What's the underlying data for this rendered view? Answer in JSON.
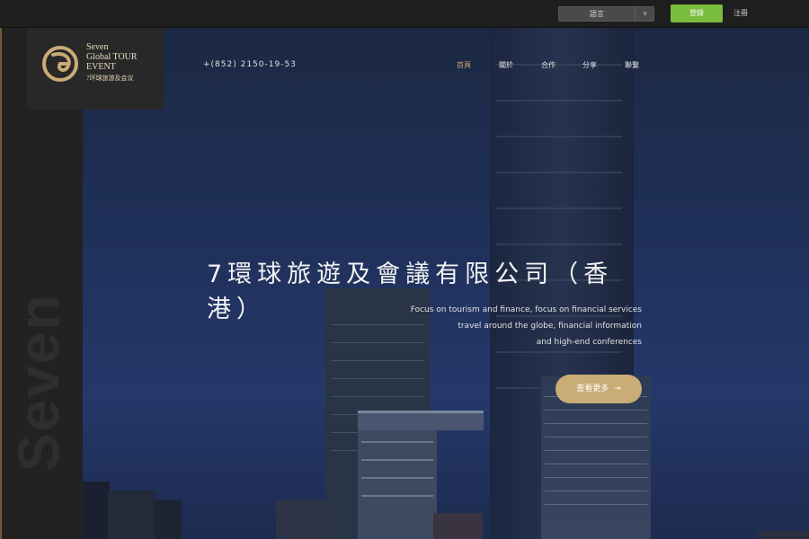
{
  "topbar": {
    "language_label": "語言",
    "language_caret": "∨",
    "login_label": "登錄",
    "register_label": "注冊"
  },
  "logo": {
    "line1": "Seven",
    "line2": "Global TOUR",
    "line3": "EVENT",
    "line4": "7环球旅游及会议"
  },
  "side": {
    "background_word": "Seven"
  },
  "header": {
    "phone": "+(852) 2150-19-53",
    "nav": [
      "首頁",
      "關於",
      "合作",
      "分享",
      "聯繫"
    ],
    "active_index": 0
  },
  "hero": {
    "title": "7環球旅遊及會議有限公司（香港）",
    "taglines": [
      "Focus on tourism and finance, focus on financial services",
      "travel around the globe, financial information",
      "and high-end conferences"
    ],
    "more_label": "查看更多",
    "more_arrow": "→"
  },
  "colors": {
    "accent_gold": "#c9ac76",
    "login_green": "#7bbd3c",
    "hero_navy": "#1f3059"
  },
  "icons": [
    "logo-swirl-icon",
    "chevron-down-icon",
    "arrow-right-icon"
  ]
}
